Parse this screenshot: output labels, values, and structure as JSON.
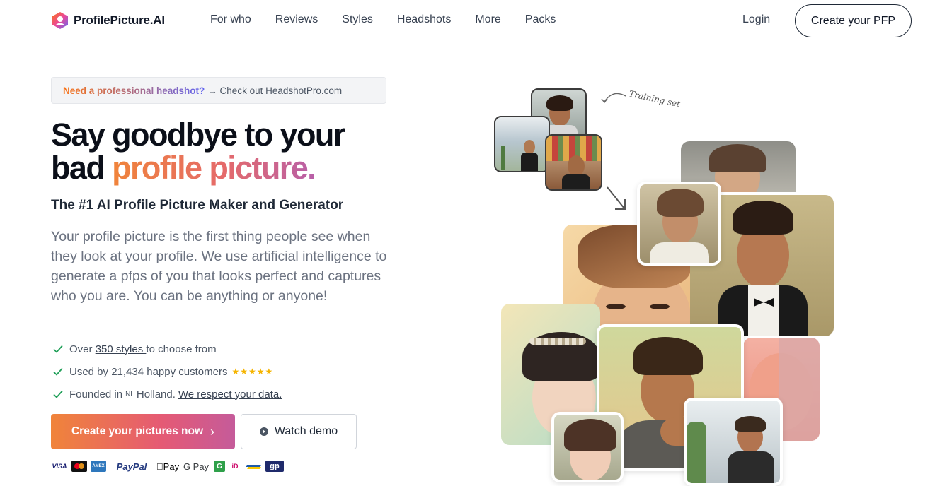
{
  "header": {
    "brand": "ProfilePicture.AI",
    "nav": [
      "For who",
      "Reviews",
      "Styles",
      "Headshots",
      "More",
      "Packs"
    ],
    "login": "Login",
    "cta": "Create your PFP"
  },
  "notice": {
    "highlight": "Need a professional headshot?",
    "rest": "→ Check out HeadshotPro.com"
  },
  "hero": {
    "title_line1": "Say goodbye to your",
    "title_line2_plain": "bad ",
    "title_line2_accent": "profile picture.",
    "subtitle": "The #1 AI Profile Picture Maker and Generator",
    "description": "Your profile picture is the first thing people see when they look at your profile. We use artificial intelligence to generate a pfps of you that looks perfect and captures who you are. You can be anything or anyone!"
  },
  "features": {
    "f1_pre": "Over ",
    "f1_link": "350 styles ",
    "f1_post": "to choose from",
    "f2_text": "Used by 21,434 happy customers",
    "f2_stars": "★★★★★",
    "f3_pre": "Founded in",
    "f3_flag": "NL",
    "f3_mid": "Holland.",
    "f3_link": "We respect your data."
  },
  "buttons": {
    "primary": "Create your pictures now",
    "primary_chevron": "›",
    "secondary": "Watch demo"
  },
  "payments": [
    "VISA",
    "MC",
    "AMEX",
    "PayPal",
    "Pay",
    "G Pay",
    "G",
    "iD",
    "B",
    "gp"
  ],
  "collage": {
    "annotation": "Training set"
  },
  "colors": {
    "accent_start": "#f0843a",
    "accent_end": "#b85fa8",
    "check": "#22a05a",
    "star": "#f5b400"
  }
}
